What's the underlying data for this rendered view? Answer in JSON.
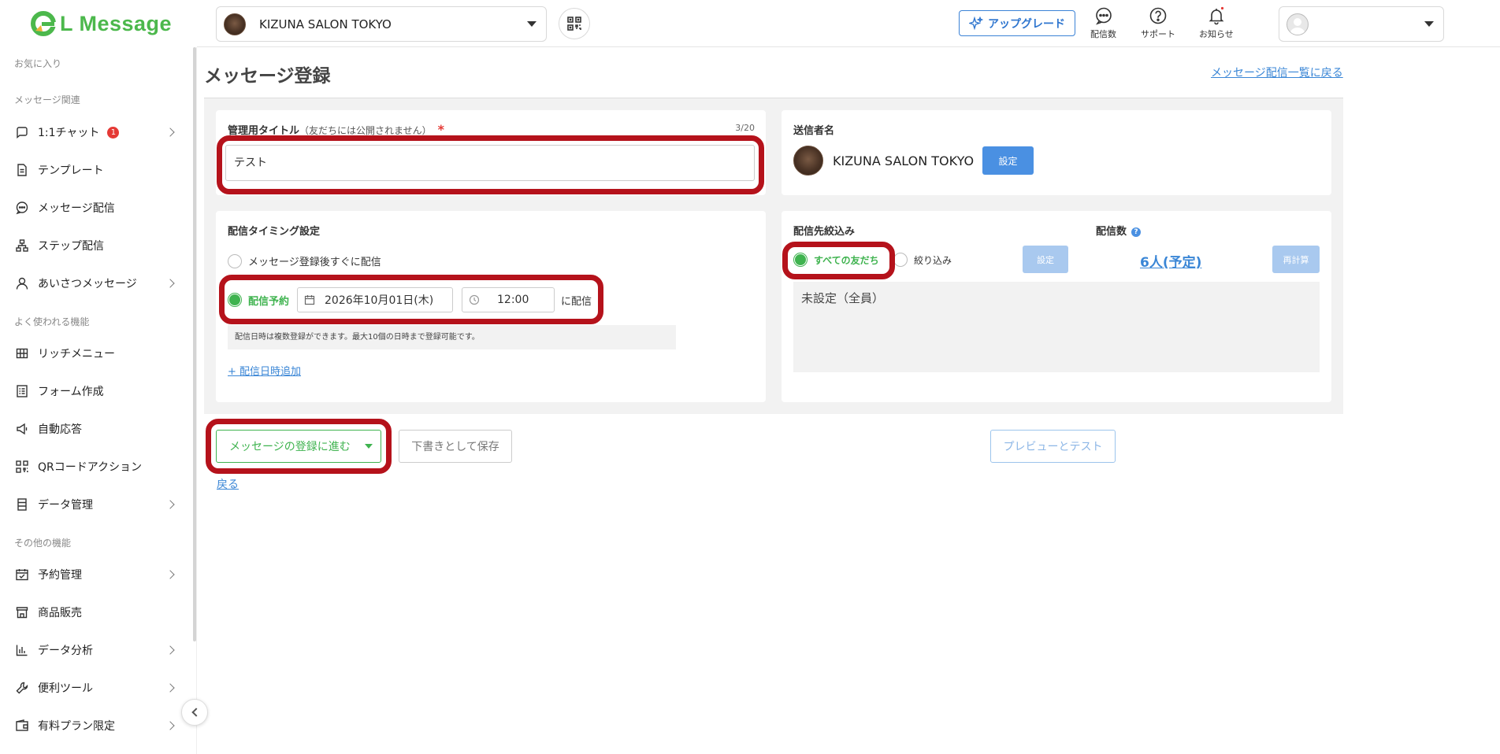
{
  "app": {
    "logo_text": "L Message",
    "brand_color": "#4cb84c",
    "accent_color": "#4a90e2",
    "highlight_color": "#b5121b"
  },
  "header": {
    "account_name": "KIZUNA SALON TOKYO",
    "upgrade_label": "アップグレード",
    "icons": [
      {
        "name": "delivery-count",
        "label": "配信数"
      },
      {
        "name": "support",
        "label": "サポート"
      },
      {
        "name": "notifications",
        "label": "お知らせ"
      }
    ]
  },
  "sidebar": {
    "sections": {
      "favorites": "お気に入り",
      "message": "メッセージ関連",
      "common": "よく使われる機能",
      "other": "その他の機能"
    },
    "items": [
      {
        "label": "1:1チャット",
        "icon": "chat-icon",
        "badge": "1",
        "chevron": true
      },
      {
        "label": "テンプレート",
        "icon": "document-icon",
        "chevron": false
      },
      {
        "label": "メッセージ配信",
        "icon": "message-icon",
        "chevron": false
      },
      {
        "label": "ステップ配信",
        "icon": "step-icon",
        "chevron": false
      },
      {
        "label": "あいさつメッセージ",
        "icon": "person-icon",
        "chevron": true
      },
      {
        "label": "リッチメニュー",
        "icon": "grid-icon",
        "chevron": false
      },
      {
        "label": "フォーム作成",
        "icon": "form-icon",
        "chevron": false
      },
      {
        "label": "自動応答",
        "icon": "megaphone-icon",
        "chevron": false
      },
      {
        "label": "QRコードアクション",
        "icon": "qr-icon",
        "chevron": false
      },
      {
        "label": "データ管理",
        "icon": "data-icon",
        "chevron": true
      },
      {
        "label": "予約管理",
        "icon": "calendar-icon",
        "chevron": true
      },
      {
        "label": "商品販売",
        "icon": "shop-icon",
        "chevron": false
      },
      {
        "label": "データ分析",
        "icon": "chart-icon",
        "chevron": true
      },
      {
        "label": "便利ツール",
        "icon": "wrench-icon",
        "chevron": true
      },
      {
        "label": "有料プラン限定",
        "icon": "wallet-icon",
        "chevron": true
      }
    ]
  },
  "page": {
    "title": "メッセージ登録",
    "back_to_list": "メッセージ配信一覧に戻る"
  },
  "title_card": {
    "label": "管理用タイトル",
    "label_note": "（友だちには公開されません）",
    "required_mark": "*",
    "counter": "3/20",
    "value": "テスト"
  },
  "sender_card": {
    "label": "送信者名",
    "name": "KIZUNA SALON TOKYO",
    "set_label": "設定"
  },
  "timing_card": {
    "label": "配信タイミング設定",
    "option_immediate": "メッセージ登録後すぐに配信",
    "option_scheduled": "配信予約",
    "selected": "scheduled",
    "date": "2026年10月01日(木)",
    "time": "12:00",
    "suffix": "に配信",
    "hint": "配信日時は複数登録ができます。最大10個の日時まで登録可能です。",
    "add_link": "+ 配信日時追加"
  },
  "target_card": {
    "label": "配信先絞込み",
    "option_all": "すべての友だち",
    "option_filter": "絞り込み",
    "selected": "all",
    "set_label": "設定",
    "count_label": "配信数",
    "count_help": "?",
    "count_value": "6人(予定)",
    "recalc_label": "再計算",
    "filter_summary": "未設定（全員）"
  },
  "actions": {
    "proceed_label": "メッセージの登録に進む",
    "draft_label": "下書きとして保存",
    "preview_label": "プレビューとテスト",
    "back_label": "戻る"
  }
}
